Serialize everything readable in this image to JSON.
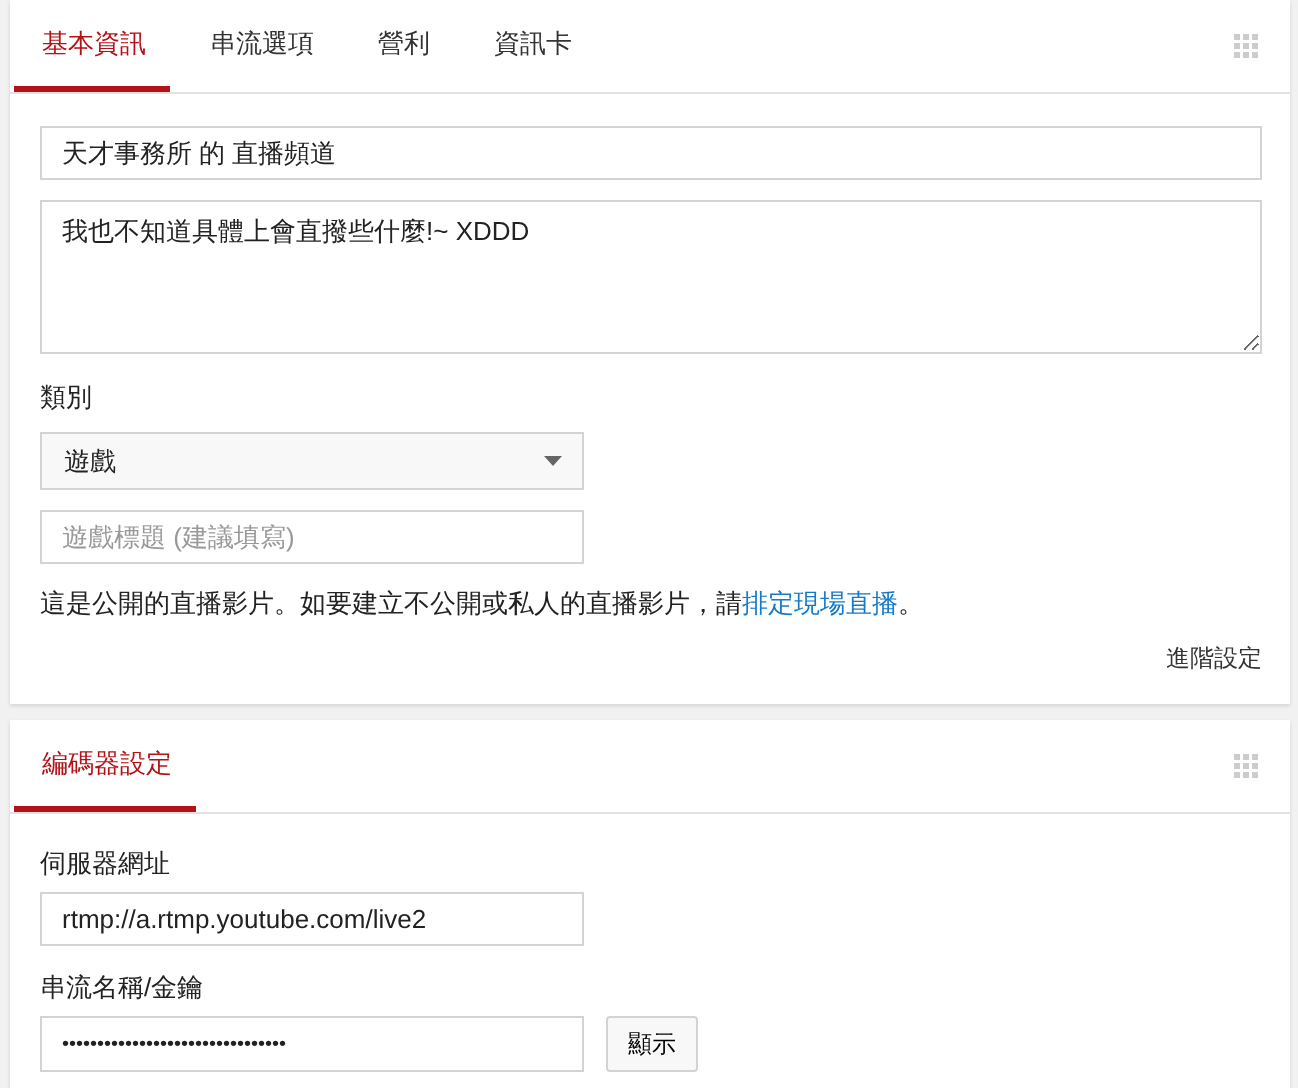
{
  "basic_card": {
    "tabs": [
      {
        "label": "基本資訊",
        "selected": true
      },
      {
        "label": "串流選項",
        "selected": false
      },
      {
        "label": "營利",
        "selected": false
      },
      {
        "label": "資訊卡",
        "selected": false
      }
    ],
    "title_field": {
      "value": "天才事務所 的 直播頻道"
    },
    "description_field": {
      "value": "我也不知道具體上會直撥些什麼!~ XDDD"
    },
    "category_label": "類別",
    "category_select": {
      "value": "遊戲"
    },
    "game_title_field": {
      "placeholder": "遊戲標題 (建議填寫)"
    },
    "notice": {
      "text_before": "這是公開的直播影片。如要建立不公開或私人的直播影片，請",
      "link": "排定現場直播",
      "text_after": "。"
    },
    "advanced_link": "進階設定"
  },
  "encoder_card": {
    "tabs": [
      {
        "label": "編碼器設定",
        "selected": true
      }
    ],
    "server_url_label": "伺服器網址",
    "server_url_field": {
      "value": "rtmp://a.rtmp.youtube.com/live2"
    },
    "stream_key_label": "串流名稱/金鑰",
    "stream_key_field": {
      "value": "••••••••••••••••••••••••••••••••"
    },
    "show_button": "顯示"
  }
}
